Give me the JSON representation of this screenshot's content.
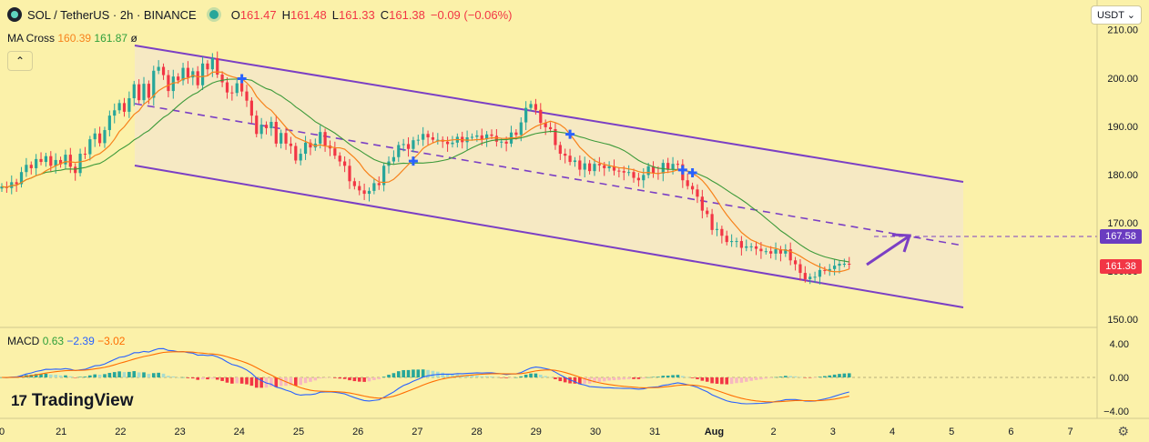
{
  "header": {
    "symbol": "SOL / TetherUS · 2h · BINANCE",
    "o_label": "O",
    "o_value": "161.47",
    "h_label": "H",
    "h_value": "161.48",
    "l_label": "L",
    "l_value": "161.33",
    "c_label": "C",
    "c_value": "161.38",
    "change": "−0.09 (−0.06%)",
    "currency": "USDT ⌄"
  },
  "ma_indicator": {
    "label": "MA Cross",
    "v1": "160.39",
    "v2": "161.87",
    "icon": "hidden-eye-icon"
  },
  "macd_indicator": {
    "label": "MACD",
    "v1": "0.63",
    "v2": "−2.39",
    "v3": "−3.02"
  },
  "brand": {
    "name": "TradingView"
  },
  "colors": {
    "background": "#fbf1a9",
    "up": "#26a69a",
    "down": "#f23645",
    "channel": "#7b3fc4",
    "ma_fast": "#f7821b",
    "ma_slow": "#2e9f3a",
    "macd": "#2962ff",
    "signal": "#ff6d00"
  },
  "chart_data": {
    "type": "candlestick",
    "price_axis": {
      "ticks": [
        "210.00",
        "200.00",
        "190.00",
        "180.00",
        "170.00",
        "160.00",
        "150.00"
      ],
      "min": 150,
      "max": 212
    },
    "macd_axis": {
      "ticks": [
        "4.00",
        "0.00",
        "−4.00"
      ],
      "min": -6.5,
      "max": 6.5
    },
    "time_labels": [
      "0",
      "21",
      "22",
      "23",
      "24",
      "25",
      "26",
      "27",
      "28",
      "29",
      "30",
      "31",
      "Aug",
      "2",
      "3",
      "4",
      "5",
      "6",
      "7"
    ],
    "last_price": "161.38",
    "target_price": "167.58",
    "closes": [
      177.5,
      177.2,
      178.4,
      178.0,
      180.5,
      182.0,
      181.3,
      183.2,
      182.6,
      183.8,
      181.8,
      183.0,
      182.1,
      184.1,
      181.6,
      180.3,
      184.3,
      184.2,
      187.3,
      188.5,
      186.5,
      189.2,
      192.2,
      193.3,
      194.8,
      193.0,
      195.8,
      198.7,
      195.4,
      198.8,
      195.9,
      201.5,
      202.3,
      200.6,
      197.3,
      200.3,
      199.5,
      202.1,
      200.1,
      201.4,
      198.5,
      203.0,
      201.8,
      204.1,
      200.7,
      199.1,
      197.0,
      196.9,
      198.9,
      197.2,
      195.3,
      192.2,
      188.4,
      190.3,
      189.6,
      190.9,
      186.4,
      188.6,
      186.4,
      185.9,
      182.9,
      184.3,
      186.6,
      185.6,
      186.4,
      188.8,
      186.0,
      185.4,
      183.9,
      182.7,
      181.8,
      178.6,
      177.6,
      176.7,
      176.0,
      176.6,
      178.2,
      177.8,
      181.8,
      182.7,
      183.6,
      186.1,
      186.3,
      185.3,
      187.1,
      187.2,
      188.4,
      187.7,
      187.2,
      187.2,
      186.8,
      186.3,
      186.6,
      187.8,
      186.7,
      187.7,
      187.8,
      188.1,
      187.3,
      188.3,
      188.0,
      186.8,
      186.8,
      186.4,
      188.7,
      188.2,
      190.8,
      193.8,
      194.6,
      193.4,
      190.7,
      189.8,
      189.4,
      186.1,
      184.3,
      183.9,
      182.6,
      182.9,
      181.0,
      182.3,
      180.7,
      182.2,
      181.9,
      181.3,
      181.7,
      180.8,
      180.7,
      180.4,
      180.5,
      179.3,
      178.8,
      179.9,
      181.7,
      180.3,
      180.2,
      182.4,
      181.0,
      182.2,
      182.1,
      178.8,
      177.6,
      176.9,
      175.4,
      172.5,
      171.8,
      168.5,
      168.7,
      167.3,
      166.0,
      166.2,
      166.2,
      164.8,
      165.1,
      165.1,
      164.6,
      164.1,
      164.1,
      163.6,
      164.5,
      163.6,
      164.5,
      162.2,
      161.4,
      159.6,
      158.3,
      158.8,
      158.8,
      160.2,
      160.0,
      160.4,
      161.1,
      161.5,
      161.5,
      161.4
    ]
  }
}
